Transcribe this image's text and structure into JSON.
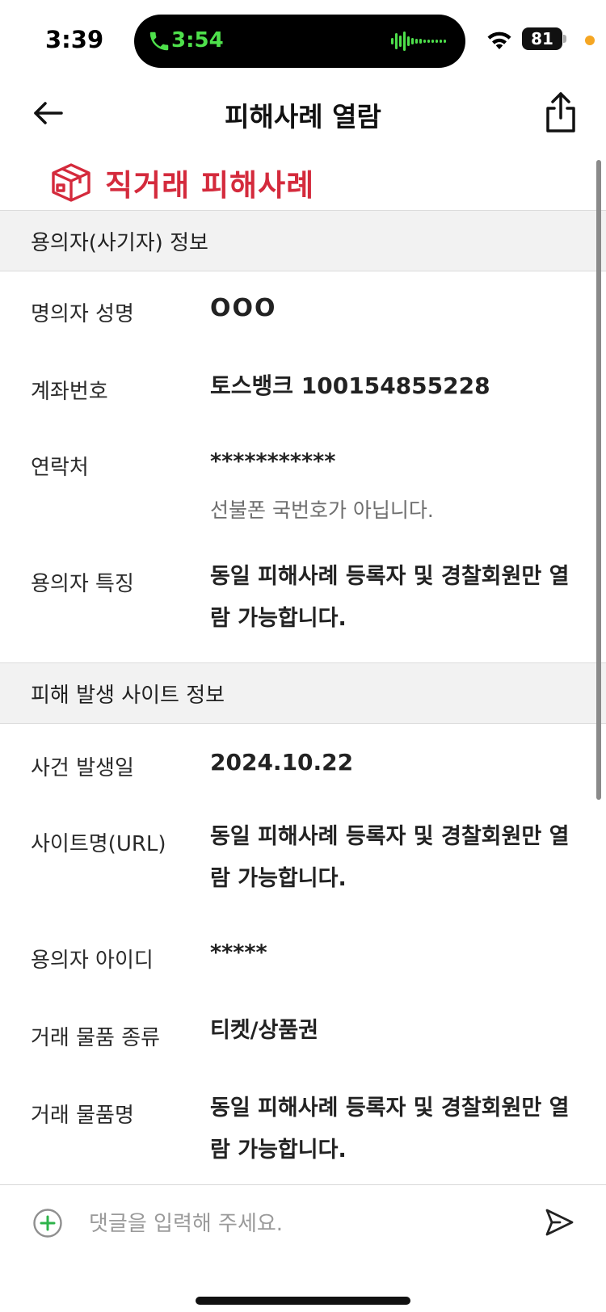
{
  "status_bar": {
    "time": "3:39",
    "call_time": "3:54",
    "battery": "81"
  },
  "header": {
    "title": "피해사례 열람",
    "back_icon": "arrow-left-icon",
    "share_icon": "share-icon"
  },
  "category": {
    "title": "직거래 피해사례",
    "icon": "box-icon",
    "color": "#d42a3c"
  },
  "sections": {
    "suspect": {
      "title": "용의자(사기자) 정보",
      "rows": {
        "name": {
          "label": "명의자 성명",
          "value": "OOO"
        },
        "account": {
          "label": "계좌번호",
          "value": "토스뱅크 100154855228"
        },
        "contact": {
          "label": "연락처",
          "value": "***********",
          "note": "선불폰 국번호가 아닙니다."
        },
        "traits": {
          "label": "용의자 특징",
          "value": "동일 피해사례 등록자 및 경찰회원만 열람 가능합니다."
        }
      }
    },
    "site": {
      "title": "피해 발생 사이트 정보",
      "rows": {
        "date": {
          "label": "사건 발생일",
          "value": "2024.10.22"
        },
        "site_name": {
          "label": "사이트명(URL)",
          "value": "동일 피해사례 등록자 및 경찰회원만 열람 가능합니다."
        },
        "suspect_id": {
          "label": "용의자 아이디",
          "value": "*****"
        },
        "item_type": {
          "label": "거래 물품 종류",
          "value": "티켓/상품권"
        },
        "item_name": {
          "label": "거래 물품명",
          "value": "동일 피해사례 등록자 및 경찰회원만 열람 가능합니다."
        }
      }
    }
  },
  "comment_bar": {
    "placeholder": "댓글을 입력해 주세요.",
    "add_icon": "plus-circle-icon",
    "send_icon": "send-icon",
    "accent": "#2db34a"
  }
}
